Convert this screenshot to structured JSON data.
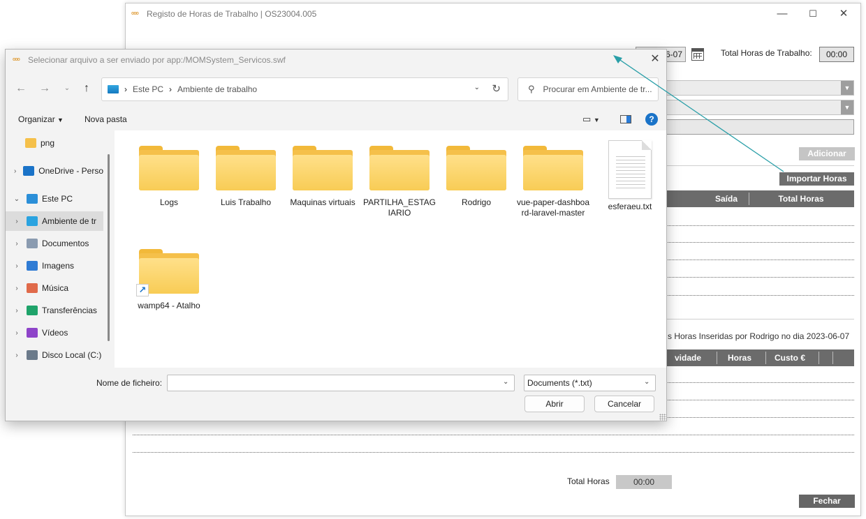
{
  "main_window": {
    "title": "Registo de Horas de Trabalho | OS23004.005",
    "date_value": "2023-06-07",
    "date_value_visible": "6-07",
    "total_hours_label": "Total Horas de Trabalho:",
    "total_hours_value": "00:00",
    "adicionar_label": "Adicionar",
    "importar_label": "Importar Horas",
    "table1_headers": [
      "Saída",
      "Total Horas"
    ],
    "info_text": "s Horas Inseridas  por Rodrigo no dia 2023-06-07",
    "table2_headers": [
      "vidade",
      "Horas",
      "Custo €"
    ],
    "total_label": "Total Horas",
    "total_value": "00:00",
    "fechar_label": "Fechar"
  },
  "dialog": {
    "title": "Selecionar arquivo a ser enviado por app:/MOMSystem_Servicos.swf",
    "breadcrumb": [
      "Este PC",
      "Ambiente de trabalho"
    ],
    "search_placeholder": "Procurar em Ambiente de tr...",
    "toolbar": {
      "organizar": "Organizar",
      "nova_pasta": "Nova pasta"
    },
    "nav_items": [
      {
        "label": "png",
        "icon": "folder-icon",
        "color": "#f5c04a",
        "expander": ""
      },
      {
        "label": "OneDrive - Perso",
        "icon": "cloud-icon",
        "color": "#1a73c8",
        "expander": ">"
      },
      {
        "label": "Este PC",
        "icon": "monitor-icon",
        "color": "#2b8fd8",
        "expander": "v"
      },
      {
        "label": "Ambiente de tr",
        "icon": "desktop-icon",
        "color": "#2aa3e0",
        "expander": ">"
      },
      {
        "label": "Documentos",
        "icon": "document-icon",
        "color": "#8a9bb0",
        "expander": ">"
      },
      {
        "label": "Imagens",
        "icon": "image-icon",
        "color": "#2f7bd4",
        "expander": ">"
      },
      {
        "label": "Música",
        "icon": "music-icon",
        "color": "#e06a4a",
        "expander": ">"
      },
      {
        "label": "Transferências",
        "icon": "download-icon",
        "color": "#1fa36a",
        "expander": ">"
      },
      {
        "label": "Vídeos",
        "icon": "video-icon",
        "color": "#8e44c9",
        "expander": ">"
      },
      {
        "label": "Disco Local (C:)",
        "icon": "drive-icon",
        "color": "#6b7a8a",
        "expander": ">"
      }
    ],
    "files": [
      {
        "name": "Logs",
        "kind": "folder"
      },
      {
        "name": "Luis Trabalho",
        "kind": "folder"
      },
      {
        "name": "Maquinas virtuais",
        "kind": "folder"
      },
      {
        "name": "PARTILHA_ESTAGIARIO",
        "kind": "folder"
      },
      {
        "name": "Rodrigo",
        "kind": "folder"
      },
      {
        "name": "vue-paper-dashboard-laravel-master",
        "kind": "folder"
      },
      {
        "name": "esferaeu.txt",
        "kind": "text"
      },
      {
        "name": "wamp64 - Atalho",
        "kind": "shortcut"
      }
    ],
    "filename_label": "Nome de ficheiro:",
    "filename_value": "",
    "filetype_value": "Documents (*.txt)",
    "abrir_label": "Abrir",
    "cancelar_label": "Cancelar"
  }
}
